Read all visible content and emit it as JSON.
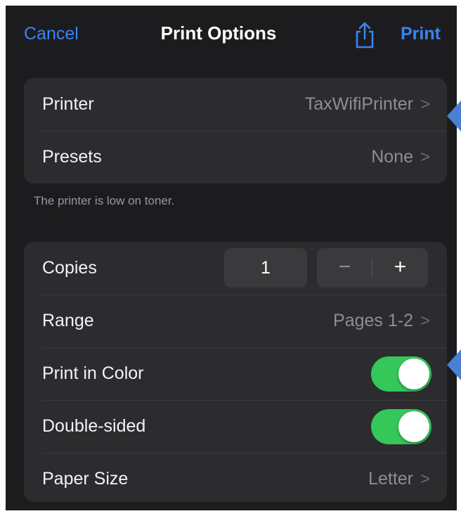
{
  "nav": {
    "cancel_label": "Cancel",
    "title": "Print Options",
    "share_icon": "share-icon",
    "print_label": "Print"
  },
  "printer_group": {
    "printer": {
      "label": "Printer",
      "value": "TaxWifiPrinter",
      "chevron": ">"
    },
    "presets": {
      "label": "Presets",
      "value": "None",
      "chevron": ">"
    }
  },
  "footnote": "The printer is low on toner.",
  "options_group": {
    "copies": {
      "label": "Copies",
      "value": "1",
      "minus": "−",
      "plus": "+"
    },
    "range": {
      "label": "Range",
      "value": "Pages 1-2",
      "chevron": ">"
    },
    "print_in_color": {
      "label": "Print in Color",
      "on": true
    },
    "double_sided": {
      "label": "Double-sided",
      "on": true
    },
    "paper_size": {
      "label": "Paper Size",
      "value": "Letter",
      "chevron": ">"
    }
  },
  "colors": {
    "accent": "#3b82f6",
    "toggle_on": "#34c759",
    "background": "#1c1c1e",
    "group_bg": "#2c2c2e",
    "annotation_marker": "#4a7fd4"
  }
}
